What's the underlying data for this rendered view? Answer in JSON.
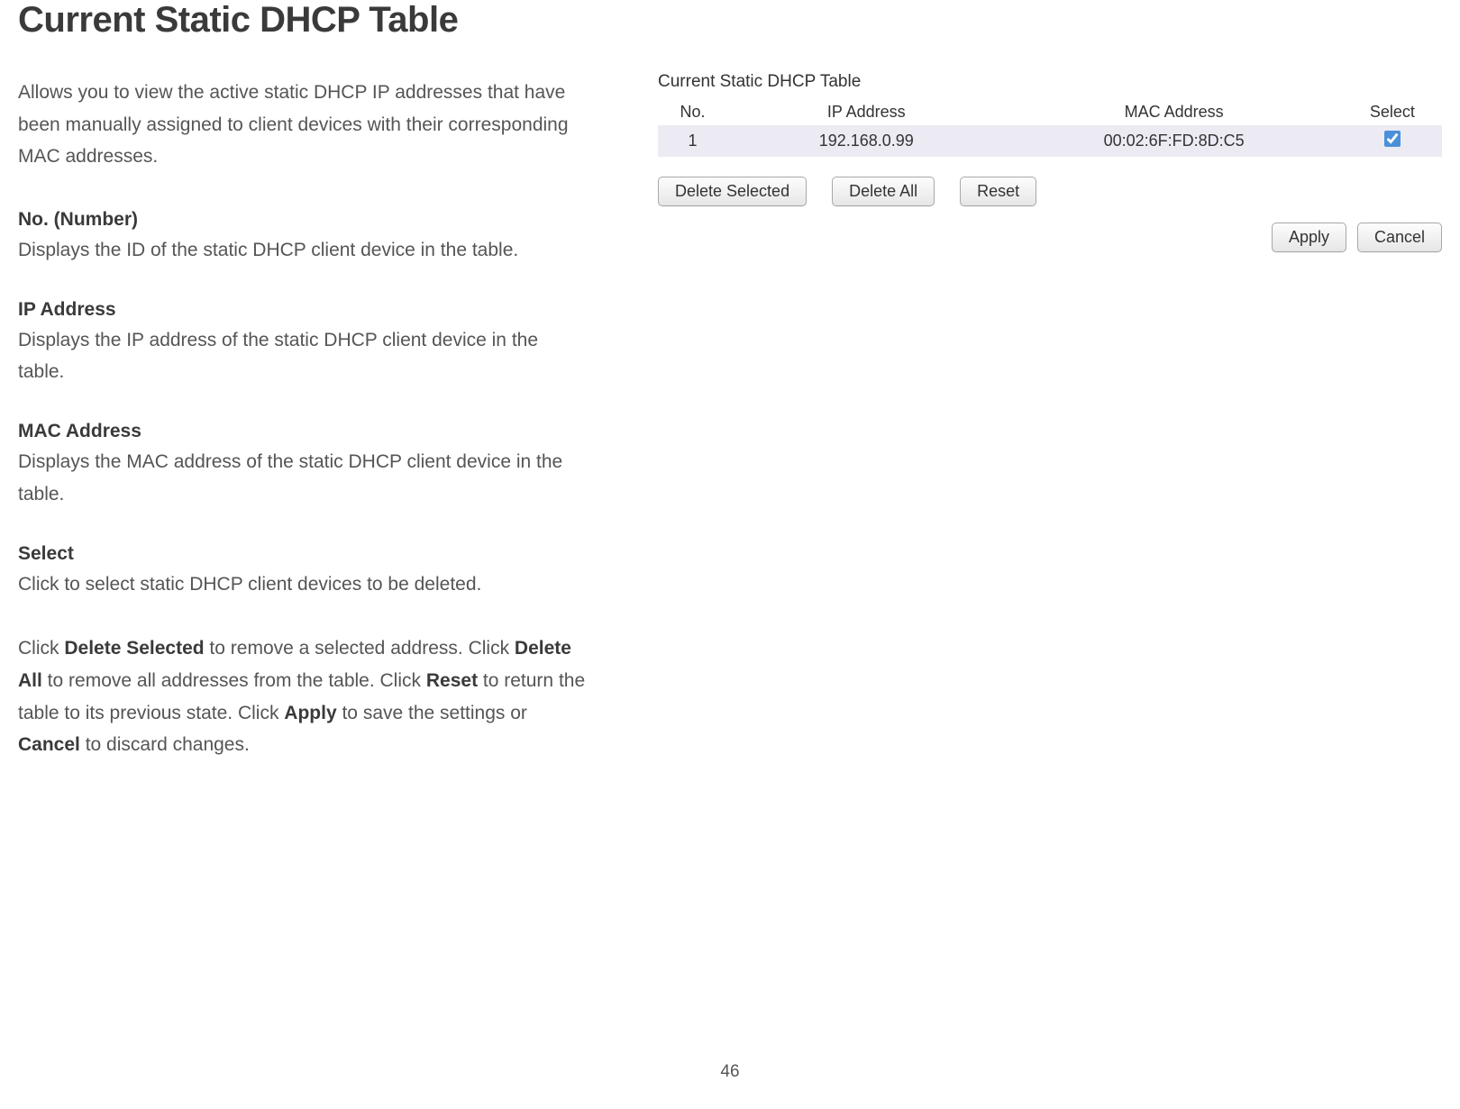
{
  "page": {
    "title": "Current Static DHCP Table",
    "intro": "Allows you to view the active static DHCP IP addresses that have been manually assigned to client devices with their corresponding MAC addresses.",
    "page_number": "46"
  },
  "definitions": [
    {
      "title": "No. (Number)",
      "body": "Displays the ID of the static DHCP client device in the table."
    },
    {
      "title": "IP Address",
      "body": "Displays the IP address of the static DHCP client device in the table."
    },
    {
      "title": "MAC Address",
      "body": "Displays the MAC address of the static DHCP client device in the table."
    },
    {
      "title": "Select",
      "body": "Click to select static DHCP client devices to be deleted."
    }
  ],
  "buttons_para": {
    "p1a": "Click ",
    "b1": "Delete Selected",
    "p1b": " to remove a selected address. Click ",
    "b2": "Delete All",
    "p1c": " to remove all addresses from the table. Click ",
    "b3": "Reset",
    "p1d": " to return the table to its previous state. Click ",
    "b4": "Apply",
    "p1e": " to save the settings or ",
    "b5": "Cancel",
    "p1f": " to discard changes."
  },
  "panel": {
    "title": "Current Static DHCP Table",
    "headers": {
      "no": "No.",
      "ip": "IP Address",
      "mac": "MAC Address",
      "select": "Select"
    },
    "rows": [
      {
        "no": "1",
        "ip": "192.168.0.99",
        "mac": "00:02:6F:FD:8D:C5",
        "selected": true
      }
    ],
    "buttons": {
      "delete_selected": "Delete Selected",
      "delete_all": "Delete All",
      "reset": "Reset",
      "apply": "Apply",
      "cancel": "Cancel"
    }
  }
}
